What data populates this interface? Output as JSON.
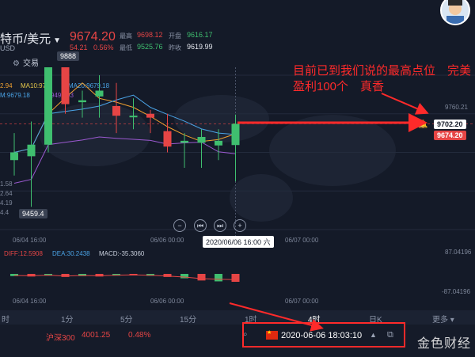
{
  "header": {
    "symbol_title": "特币/美元",
    "currency": "USD",
    "price": "9674.20",
    "change": "54.21",
    "change_pct": "0.56%",
    "stats": [
      {
        "label": "最高",
        "value": "9698.12",
        "color": "#e64545"
      },
      {
        "label": "开盘",
        "value": "9616.17",
        "color": "#3fbf6f"
      },
      {
        "label": "最低",
        "value": "9525.76",
        "color": "#3fbf6f"
      },
      {
        "label": "昨收",
        "value": "9619.99",
        "color": "#e6e9f0"
      }
    ],
    "trade_button": "交易"
  },
  "indicators": {
    "ma_partial": "2.94",
    "ma10_label": "MA10:97",
    "ma20_label": "MA20:9679.18",
    "m_label": "M:9679.18",
    "ma30_partial": "9499.93",
    "diff_label": "DIFF:12.5908",
    "dea_label": "DEA:30.2438",
    "macd_label": "MACD:-35.3060"
  },
  "price_tags": {
    "high_marker": "9888",
    "low_marker": "9459.4",
    "target_price": "9702.20",
    "current_price": "9674.20",
    "crosshair_time": "2020/06/06 16:00 六"
  },
  "axis": {
    "right_labels": [
      "9760.21",
      "87.04196",
      "-87.04196"
    ],
    "left_labels": [
      "1.58",
      "2.64",
      "4.19",
      "4.4"
    ],
    "x_labels_main": [
      "06/04 16:00",
      "06/06 00:00",
      "06/07 00:00"
    ],
    "x_labels_sub": [
      "06/04 16:00",
      "06/06 00:00",
      "06/07 00:00"
    ]
  },
  "annotation": {
    "line1": "目前已到我们说的最高点位　完美",
    "line2": "盈利100个　真香"
  },
  "chart_controls": [
    "−",
    "⏮",
    "⏭",
    "+"
  ],
  "period_tabs": [
    "时",
    "1分",
    "5分",
    "15分",
    "1时",
    "4时",
    "日K",
    "更多"
  ],
  "active_tab": "4时",
  "ticker": {
    "name": "沪深300",
    "value": "4001.25",
    "change_pct": "0.48%",
    "datetime": "2020-06-06 18:03:10"
  },
  "watermark": "金色财经",
  "colors": {
    "up": "#e64545",
    "down": "#3fbf6f",
    "ma_orange": "#f0a030",
    "ma_blue": "#4aa3e6",
    "ma_purple": "#9b59d0",
    "annotation": "#ff2a2a"
  },
  "chart_data": {
    "type": "candlestick",
    "x": [
      "06/04 12:00",
      "06/04 16:00",
      "06/04 20:00",
      "06/05 00:00",
      "06/05 04:00",
      "06/05 08:00",
      "06/05 12:00",
      "06/05 16:00",
      "06/05 20:00",
      "06/06 00:00",
      "06/06 04:00",
      "06/06 08:00",
      "06/06 12:00",
      "06/06 16:00"
    ],
    "open": [
      9580,
      9590,
      9620,
      9880,
      9730,
      9745,
      9720,
      9695,
      9700,
      9655,
      9625,
      9625,
      9618,
      9619
    ],
    "close": [
      9600,
      9620,
      9880,
      9725,
      9735,
      9760,
      9695,
      9695,
      9690,
      9615,
      9630,
      9640,
      9630,
      9674
    ],
    "high": [
      9650,
      9680,
      9888,
      9900,
      9760,
      9800,
      9780,
      9740,
      9710,
      9700,
      9650,
      9660,
      9660,
      9698
    ],
    "low": [
      9540,
      9459,
      9600,
      9700,
      9690,
      9690,
      9650,
      9660,
      9650,
      9600,
      9560,
      9560,
      9580,
      9525
    ],
    "ylim": [
      9400,
      9800
    ],
    "macd_hist": [
      -10,
      -12,
      -8,
      -14,
      -10,
      -12,
      -8,
      -6,
      -9,
      -14,
      -20,
      -30,
      -34,
      -36
    ],
    "hline": 9702.2
  }
}
